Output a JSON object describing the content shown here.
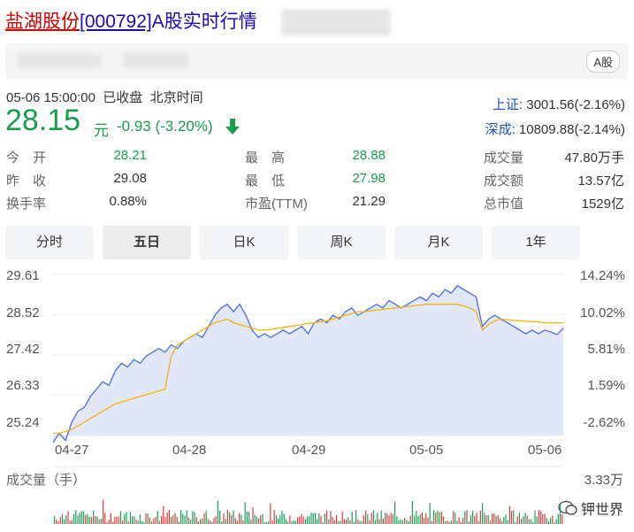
{
  "header": {
    "brand": "盐湖股份",
    "code": "[000792]",
    "suffix": "A股实时行情",
    "market_tag": "A股"
  },
  "quote": {
    "time": "05-06 15:00:00",
    "status": "已收盘",
    "tz": "北京时间",
    "price": "28.15",
    "unit": "元",
    "change": "-0.93 (-3.20%)",
    "direction": "down"
  },
  "indices": [
    {
      "name": "上证:",
      "value": "3001.56(-2.16%)"
    },
    {
      "name": "深成:",
      "value": "10809.88(-2.14%)"
    }
  ],
  "stats": {
    "open_label": "今　开",
    "open": "28.21",
    "prev_label": "昨　收",
    "prev": "29.08",
    "turnover_label": "换手率",
    "turnover": "0.88%",
    "high_label": "最　高",
    "high": "28.88",
    "low_label": "最　低",
    "low": "27.98",
    "pe_label": "市盈(TTM)",
    "pe": "21.29",
    "vol_label": "成交量",
    "vol": "47.80万手",
    "amount_label": "成交额",
    "amount": "13.57亿",
    "cap_label": "总市值",
    "cap": "1529亿"
  },
  "tabs": [
    {
      "label": "分时",
      "active": false
    },
    {
      "label": "五日",
      "active": true
    },
    {
      "label": "日K",
      "active": false
    },
    {
      "label": "周K",
      "active": false
    },
    {
      "label": "月K",
      "active": false
    },
    {
      "label": "1年",
      "active": false
    }
  ],
  "chart_data": {
    "type": "line",
    "y_ticks": [
      "29.61",
      "28.52",
      "27.42",
      "26.33",
      "25.24"
    ],
    "y_range": [
      25.24,
      29.61
    ],
    "right_ticks": [
      "14.24%",
      "10.02%",
      "5.81%",
      "1.59%",
      "-2.62%"
    ],
    "x_ticks": [
      "04-27",
      "04-28",
      "04-29",
      "05-05",
      "05-06"
    ],
    "series": [
      {
        "color": "#4a6ee0",
        "values": [
          25.05,
          25.3,
          25.1,
          25.6,
          25.9,
          26.0,
          26.3,
          26.5,
          26.7,
          26.6,
          27.0,
          27.2,
          27.1,
          27.3,
          27.2,
          27.4,
          27.5,
          27.6,
          27.5,
          27.7,
          27.6,
          27.8,
          27.9,
          28.0,
          27.9,
          28.2,
          28.5,
          28.7,
          28.8,
          28.6,
          28.8,
          28.5,
          28.1,
          27.9,
          28.0,
          27.9,
          28.0,
          28.1,
          28.0,
          28.1,
          28.2,
          28.0,
          28.3,
          28.4,
          28.3,
          28.5,
          28.4,
          28.6,
          28.7,
          28.5,
          28.6,
          28.7,
          28.8,
          28.7,
          28.9,
          28.8,
          28.7,
          28.8,
          28.9,
          29.0,
          28.9,
          29.1,
          29.0,
          29.2,
          29.1,
          29.3,
          29.2,
          29.1,
          29.0,
          28.2,
          28.4,
          28.5,
          28.4,
          28.3,
          28.2,
          28.1,
          28.0,
          28.1,
          28.0,
          28.1,
          28.05,
          27.98,
          28.15
        ]
      },
      {
        "color": "#f0b020",
        "values": [
          25.3,
          25.3,
          25.35,
          25.4,
          25.5,
          25.6,
          25.7,
          25.8,
          25.9,
          26.0,
          26.1,
          26.15,
          26.2,
          26.25,
          26.3,
          26.35,
          26.4,
          26.45,
          26.5,
          27.4,
          27.7,
          27.8,
          27.9,
          28.0,
          28.1,
          28.2,
          28.3,
          28.35,
          28.4,
          28.3,
          28.25,
          28.2,
          28.15,
          28.1,
          28.1,
          28.12,
          28.15,
          28.17,
          28.2,
          28.22,
          28.25,
          28.28,
          28.3,
          28.33,
          28.35,
          28.4,
          28.45,
          28.5,
          28.55,
          28.6,
          28.6,
          28.62,
          28.64,
          28.66,
          28.68,
          28.7,
          28.72,
          28.74,
          28.76,
          28.78,
          28.8,
          28.8,
          28.8,
          28.8,
          28.8,
          28.8,
          28.75,
          28.7,
          28.6,
          28.1,
          28.25,
          28.35,
          28.4,
          28.38,
          28.36,
          28.35,
          28.34,
          28.33,
          28.32,
          28.3,
          28.3,
          28.3,
          28.3
        ]
      }
    ]
  },
  "volume": {
    "title": "成交量（手）",
    "max": "3.33万"
  },
  "watermark": "钾世界"
}
